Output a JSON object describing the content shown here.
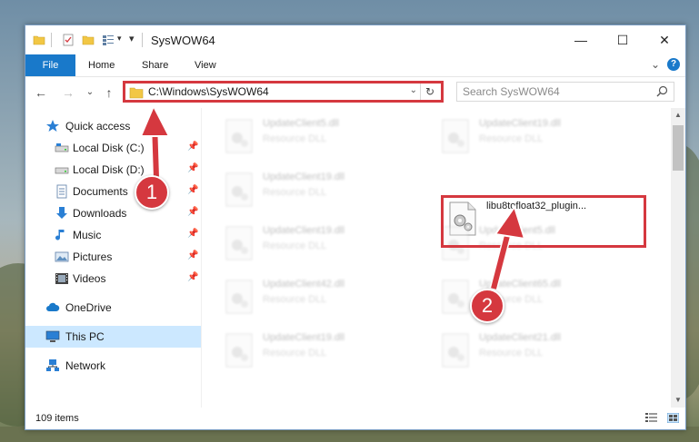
{
  "window": {
    "title": "SysWOW64",
    "minimize_glyph": "—",
    "maximize_glyph": "☐",
    "close_glyph": "✕"
  },
  "ribbon": {
    "tabs": [
      "File",
      "Home",
      "Share",
      "View"
    ],
    "collapse_glyph": "⌄",
    "help_glyph": "?"
  },
  "nav": {
    "back_glyph": "←",
    "forward_glyph": "→",
    "recent_glyph": "⌄",
    "up_glyph": "↑",
    "address_path": "C:\\Windows\\SysWOW64",
    "address_dropdown_glyph": "⌄",
    "refresh_glyph": "↻",
    "search_placeholder": "Search SysWOW64"
  },
  "sidebar": {
    "items": [
      {
        "label": "Quick access",
        "icon": "star-icon"
      },
      {
        "label": "Local Disk (C:)",
        "icon": "drive-icon",
        "pinned": true
      },
      {
        "label": "Local Disk (D:)",
        "icon": "drive-icon",
        "pinned": true
      },
      {
        "label": "Documents",
        "icon": "documents-icon",
        "pinned": true
      },
      {
        "label": "Downloads",
        "icon": "downloads-icon",
        "pinned": true
      },
      {
        "label": "Music",
        "icon": "music-icon",
        "pinned": true
      },
      {
        "label": "Pictures",
        "icon": "pictures-icon",
        "pinned": true
      },
      {
        "label": "Videos",
        "icon": "videos-icon",
        "pinned": true
      },
      {
        "label": "OneDrive",
        "icon": "cloud-icon"
      },
      {
        "label": "This PC",
        "icon": "computer-icon",
        "selected": true
      },
      {
        "label": "Network",
        "icon": "network-icon"
      }
    ],
    "pin_glyph": "📌"
  },
  "files": [
    {
      "name": "UpdateClient5.dll",
      "type": "Resource DLL"
    },
    {
      "name": "UpdateClient19.dll",
      "type": "Resource DLL"
    },
    {
      "name": "UpdateClient19.dll",
      "type": "Resource DLL"
    },
    {
      "name": "libu8tofloat32_plugin...",
      "type": ""
    },
    {
      "name": "UpdateClient19.dll",
      "type": "Resource DLL"
    },
    {
      "name": "UpdateClient5.dll",
      "type": "Resource DLL"
    },
    {
      "name": "UpdateClient42.dll",
      "type": "Resource DLL"
    },
    {
      "name": "UpdateClient65.dll",
      "type": "Resource DLL"
    },
    {
      "name": "UpdateClient19.dll",
      "type": "Resource DLL"
    },
    {
      "name": "UpdateClient21.dll",
      "type": "Resource DLL"
    }
  ],
  "status": {
    "item_count": "109 items"
  },
  "annotations": {
    "step1": "1",
    "step2": "2",
    "color": "#d5383f"
  },
  "colors": {
    "accent": "#1979ca",
    "selection": "#cce8ff",
    "highlight_border": "#d5383f"
  }
}
